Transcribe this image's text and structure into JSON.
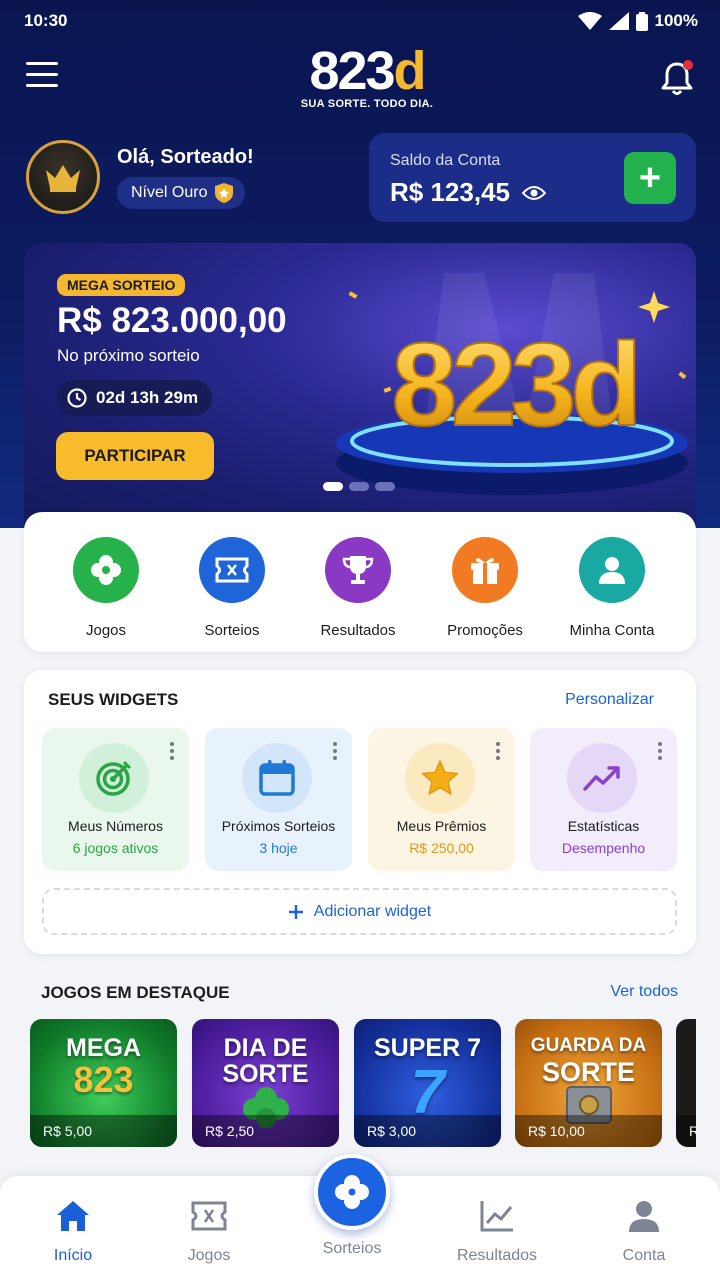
{
  "status_bar": {
    "time": "10:30",
    "battery": "100%"
  },
  "header": {
    "logo_text": "823",
    "logo_accent": "d",
    "tagline": "SUA SORTE. TODO DIA."
  },
  "user": {
    "greeting": "Olá, Sorteado!",
    "level": "Nível Ouro"
  },
  "balance": {
    "label": "Saldo da Conta",
    "value": "R$ 123,45",
    "add_label": "+"
  },
  "banner": {
    "badge": "MEGA SORTEIO",
    "prize": "R$ 823.000,00",
    "subtitle": "No próximo sorteio",
    "countdown": "02d 13h 29m",
    "cta": "PARTICIPAR",
    "art_text": "823d",
    "slides": 3,
    "active_slide": 1
  },
  "quick_actions": [
    {
      "label": "Jogos",
      "icon": "clover-icon",
      "color": "#27b14a"
    },
    {
      "label": "Sorteios",
      "icon": "ticket-icon",
      "color": "#1f64d8"
    },
    {
      "label": "Resultados",
      "icon": "trophy-icon",
      "color": "#8a39c4"
    },
    {
      "label": "Promoções",
      "icon": "gift-icon",
      "color": "#f17a22"
    },
    {
      "label": "Minha Conta",
      "icon": "user-icon",
      "color": "#1aa8a3"
    }
  ],
  "widgets": {
    "title": "SEUS WIDGETS",
    "customize": "Personalizar",
    "add": "Adicionar widget",
    "items": [
      {
        "title": "Meus Números",
        "subtitle": "6 jogos ativos",
        "icon": "target-icon",
        "bg": "#e9f7ec",
        "color": "#27a645"
      },
      {
        "title": "Próximos Sorteios",
        "subtitle": "3 hoje",
        "icon": "calendar-icon",
        "bg": "#e8f2fc",
        "color": "#1f7ad6"
      },
      {
        "title": "Meus Prêmios",
        "subtitle": "R$ 250,00",
        "icon": "star-icon",
        "bg": "#fdf5e3",
        "color": "#e39a12"
      },
      {
        "title": "Estatísticas",
        "subtitle": "Desempenho",
        "icon": "trend-icon",
        "bg": "#f2ecfb",
        "color": "#8a3fd0"
      }
    ]
  },
  "featured": {
    "title": "JOGOS EM DESTAQUE",
    "see_all": "Ver todos",
    "games": [
      {
        "line1": "MEGA",
        "line2": "823",
        "price": "R$ 5,00"
      },
      {
        "line1": "DIA DE",
        "line2": "SORTE",
        "price": "R$ 2,50"
      },
      {
        "line1": "SUPER 7",
        "line2": "7",
        "price": "R$ 3,00"
      },
      {
        "line1": "GUARDA DA",
        "line2": "SORTE",
        "price": "R$ 10,00"
      },
      {
        "line1": "",
        "line2": "",
        "price": "R"
      }
    ]
  },
  "bottom_nav": [
    {
      "label": "Início",
      "icon": "home-icon",
      "active": true
    },
    {
      "label": "Jogos",
      "icon": "ticket-icon",
      "active": false
    },
    {
      "label": "Sorteios",
      "icon": "clover-icon",
      "active": false
    },
    {
      "label": "Resultados",
      "icon": "chart-icon",
      "active": false
    },
    {
      "label": "Conta",
      "icon": "user-icon",
      "active": false
    }
  ],
  "colors": {
    "primary": "#1b63e0",
    "accent": "#f5b731",
    "navy": "#0d1d63",
    "success": "#22b14c"
  }
}
